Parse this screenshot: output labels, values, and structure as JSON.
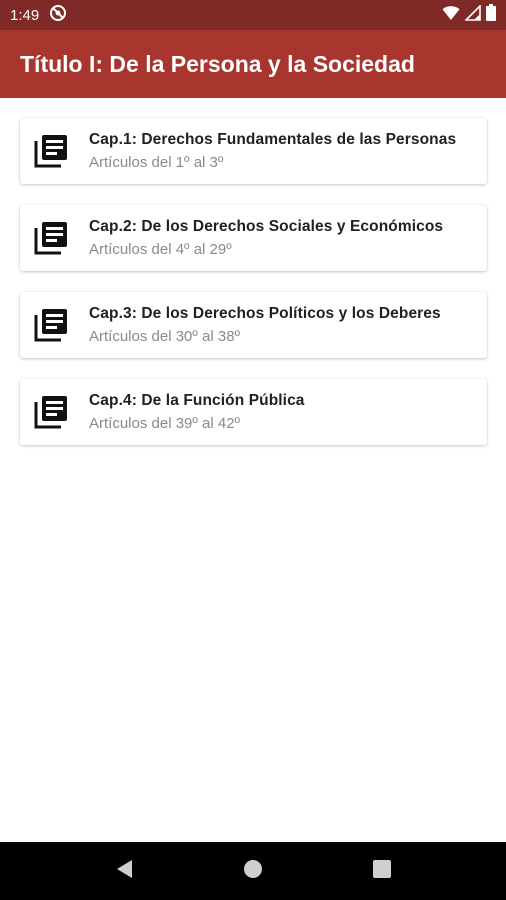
{
  "status_bar": {
    "time": "1:49"
  },
  "app_bar": {
    "title": "Título I: De la Persona y la Sociedad",
    "color": "#a8352e",
    "status_color": "#7f2a26"
  },
  "chapters": [
    {
      "title": "Cap.1: Derechos Fundamentales de las Personas",
      "subtitle": "Artículos del 1º al 3º"
    },
    {
      "title": "Cap.2: De los Derechos Sociales y Económicos",
      "subtitle": "Artículos del 4º al 29º"
    },
    {
      "title": "Cap.3: De los Derechos Políticos y los Deberes",
      "subtitle": "Artículos del 30º al 38º"
    },
    {
      "title": "Cap.4: De la Función Pública",
      "subtitle": "Artículos del 39º al 42º"
    }
  ],
  "icons": {
    "chapter": "library-books-icon",
    "back": "back-triangle-icon",
    "home": "home-circle-icon",
    "recents": "recents-square-icon"
  }
}
